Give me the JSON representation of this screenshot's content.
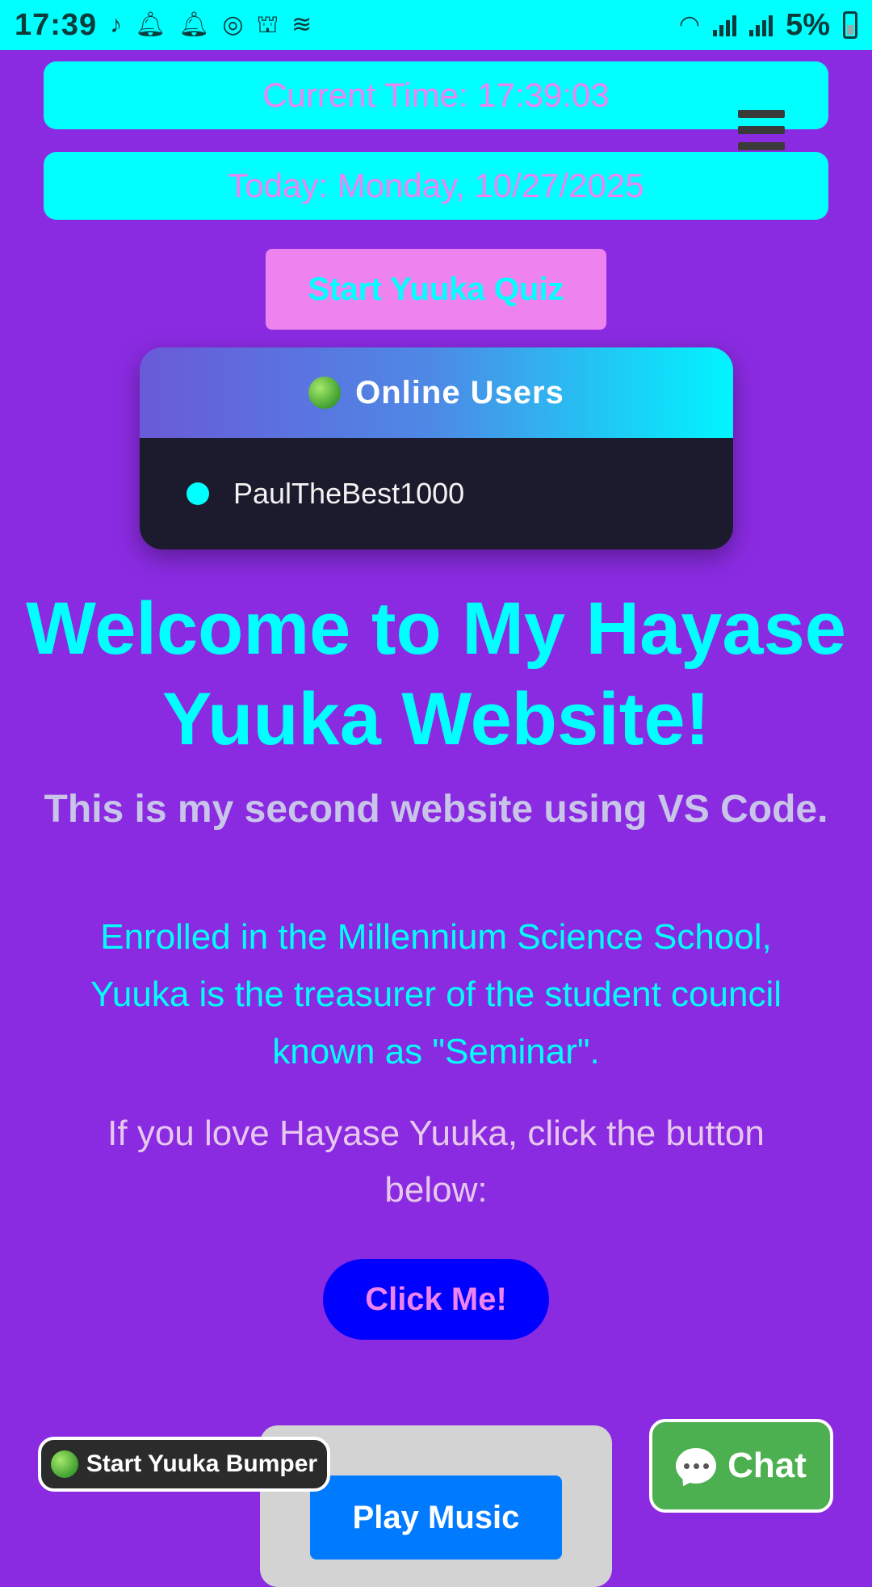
{
  "status_bar": {
    "time": "17:39",
    "battery_percent": "5%",
    "icons": [
      "music-note-icon",
      "bell-icon",
      "bell-icon",
      "shazam-icon",
      "incognito-icon",
      "signal-wave-icon",
      "wifi-icon",
      "cell-signal-icon",
      "cell-signal-icon",
      "battery-icon"
    ]
  },
  "header": {
    "current_time": "Current Time: 17:39:03",
    "today": "Today: Monday, 10/27/2025",
    "menu_icon": "hamburger-menu-icon"
  },
  "quiz_button": "Start Yuuka Quiz",
  "online_users": {
    "title": "Online Users",
    "users": [
      "PaulTheBest1000"
    ]
  },
  "main": {
    "welcome": "Welcome to My Hayase Yuuka Website!",
    "subtitle": "This is my second website using VS Code.",
    "description": "Enrolled in the Millennium Science School, Yuuka is the treasurer of the student council known as \"Seminar\".",
    "love_text": "If you love Hayase Yuuka, click the button below:",
    "click_button": "Click Me!"
  },
  "music": {
    "play_button": "Play Music"
  },
  "bumper_button": "Start Yuuka Bumper",
  "chat_button": "Chat",
  "colors": {
    "background": "#8a2be2",
    "accent_cyan": "#00ffff",
    "accent_violet": "#ee82ee",
    "chat_green": "#4caf50",
    "play_blue": "#007bff"
  }
}
